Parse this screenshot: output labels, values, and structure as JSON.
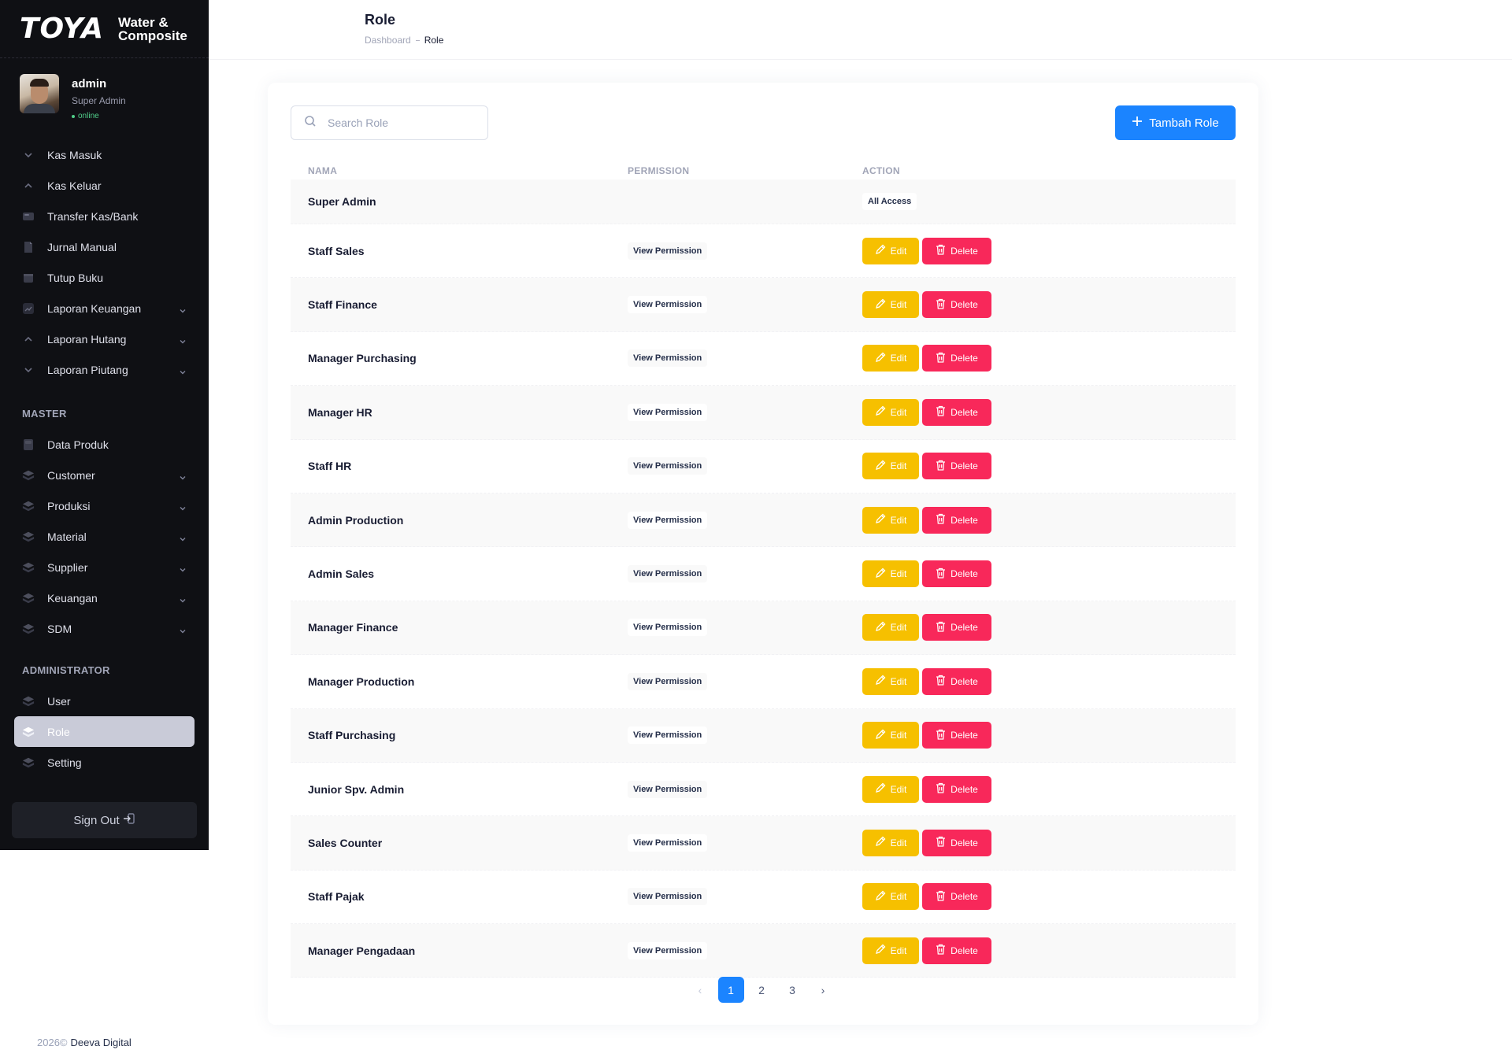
{
  "brand": {
    "logo": "TOYA",
    "sub_line1": "Water &",
    "sub_line2": "Composite"
  },
  "profile": {
    "name": "admin",
    "role": "Super Admin",
    "status": "online"
  },
  "sidebar": {
    "items": [
      {
        "label": "Kas Masuk",
        "icon": "arrow-down-icon",
        "chevron": false
      },
      {
        "label": "Kas Keluar",
        "icon": "arrow-up-icon",
        "chevron": false
      },
      {
        "label": "Transfer Kas/Bank",
        "icon": "card-icon",
        "chevron": false
      },
      {
        "label": "Jurnal Manual",
        "icon": "document-icon",
        "chevron": false
      },
      {
        "label": "Tutup Buku",
        "icon": "calendar-icon",
        "chevron": false
      },
      {
        "label": "Laporan Keuangan",
        "icon": "chart-icon",
        "chevron": true
      },
      {
        "label": "Laporan Hutang",
        "icon": "arrow-up-icon",
        "chevron": true
      },
      {
        "label": "Laporan Piutang",
        "icon": "arrow-down-icon",
        "chevron": true
      }
    ],
    "master_title": "MASTER",
    "master_items": [
      {
        "label": "Data Produk",
        "icon": "box-icon",
        "chevron": false
      },
      {
        "label": "Customer",
        "icon": "layers-icon",
        "chevron": true
      },
      {
        "label": "Produksi",
        "icon": "layers-icon",
        "chevron": true
      },
      {
        "label": "Material",
        "icon": "layers-icon",
        "chevron": true
      },
      {
        "label": "Supplier",
        "icon": "layers-icon",
        "chevron": true
      },
      {
        "label": "Keuangan",
        "icon": "layers-icon",
        "chevron": true
      },
      {
        "label": "SDM",
        "icon": "layers-icon",
        "chevron": true
      }
    ],
    "admin_title": "ADMINISTRATOR",
    "admin_items": [
      {
        "label": "User",
        "icon": "layers-icon",
        "active": false
      },
      {
        "label": "Role",
        "icon": "layers-icon",
        "active": true
      },
      {
        "label": "Setting",
        "icon": "layers-icon",
        "active": false
      }
    ],
    "signout_label": "Sign Out"
  },
  "header": {
    "title": "Role",
    "breadcrumb_root": "Dashboard",
    "breadcrumb_current": "Role"
  },
  "search": {
    "placeholder": "Search Role",
    "value": ""
  },
  "add_button_label": "Tambah Role",
  "table": {
    "columns": [
      "NAMA",
      "PERMISSION",
      "ACTION"
    ],
    "rows": [
      {
        "name": "Super Admin",
        "permission": "",
        "access": "All Access"
      },
      {
        "name": "Staff Sales",
        "permission": "View Permission"
      },
      {
        "name": "Staff Finance",
        "permission": "View Permission"
      },
      {
        "name": "Manager Purchasing",
        "permission": "View Permission"
      },
      {
        "name": "Manager HR",
        "permission": "View Permission"
      },
      {
        "name": "Staff HR",
        "permission": "View Permission"
      },
      {
        "name": "Admin Production",
        "permission": "View Permission"
      },
      {
        "name": "Admin Sales",
        "permission": "View Permission"
      },
      {
        "name": "Manager Finance",
        "permission": "View Permission"
      },
      {
        "name": "Manager Production",
        "permission": "View Permission"
      },
      {
        "name": "Staff Purchasing",
        "permission": "View Permission"
      },
      {
        "name": "Junior Spv. Admin",
        "permission": "View Permission"
      },
      {
        "name": "Sales Counter",
        "permission": "View Permission"
      },
      {
        "name": "Staff Pajak",
        "permission": "View Permission"
      },
      {
        "name": "Manager Pengadaan",
        "permission": "View Permission"
      }
    ],
    "edit_label": "Edit",
    "delete_label": "Delete"
  },
  "pagination": {
    "prev": "‹",
    "pages": [
      "1",
      "2",
      "3"
    ],
    "current": "1",
    "next": "›"
  },
  "footer": {
    "year": "2026©",
    "company": "Deeva Digital"
  },
  "colors": {
    "primary": "#1b84ff",
    "warning": "#f6c000",
    "danger": "#f8285a",
    "sidebar_bg": "#0f1014"
  }
}
